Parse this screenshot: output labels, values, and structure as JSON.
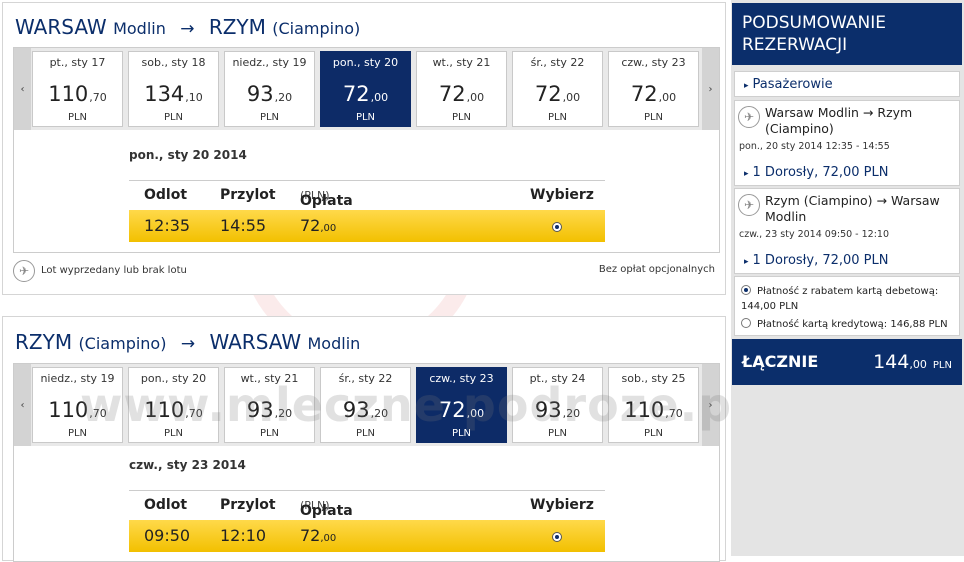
{
  "outbound": {
    "from_city": "WARSAW",
    "from_airport": "Modlin",
    "to_city": "RZYM",
    "to_airport": "(Ciampino)",
    "arrow": "→",
    "dates": [
      {
        "label": "pt., sty 17",
        "main": "110",
        "dec": ",70",
        "currency": "PLN",
        "selected": false
      },
      {
        "label": "sob., sty 18",
        "main": "134",
        "dec": ",10",
        "currency": "PLN",
        "selected": false
      },
      {
        "label": "niedz., sty 19",
        "main": "93",
        "dec": ",20",
        "currency": "PLN",
        "selected": false
      },
      {
        "label": "pon., sty 20",
        "main": "72",
        "dec": ",00",
        "currency": "PLN",
        "selected": true
      },
      {
        "label": "wt., sty 21",
        "main": "72",
        "dec": ",00",
        "currency": "PLN",
        "selected": false
      },
      {
        "label": "śr., sty 22",
        "main": "72",
        "dec": ",00",
        "currency": "PLN",
        "selected": false
      },
      {
        "label": "czw., sty 23",
        "main": "72",
        "dec": ",00",
        "currency": "PLN",
        "selected": false
      }
    ],
    "selected_date": "pon., sty 20 2014",
    "flight": {
      "depart": "12:35",
      "arrive": "14:55",
      "price_main": "72",
      "price_dec": ",00"
    }
  },
  "return": {
    "from_city": "RZYM",
    "from_airport": "(Ciampino)",
    "to_city": "WARSAW",
    "to_airport": "Modlin",
    "arrow": "→",
    "dates": [
      {
        "label": "niedz., sty 19",
        "main": "110",
        "dec": ",70",
        "currency": "PLN",
        "selected": false
      },
      {
        "label": "pon., sty 20",
        "main": "110",
        "dec": ",70",
        "currency": "PLN",
        "selected": false
      },
      {
        "label": "wt., sty 21",
        "main": "93",
        "dec": ",20",
        "currency": "PLN",
        "selected": false
      },
      {
        "label": "śr., sty 22",
        "main": "93",
        "dec": ",20",
        "currency": "PLN",
        "selected": false
      },
      {
        "label": "czw., sty 23",
        "main": "72",
        "dec": ",00",
        "currency": "PLN",
        "selected": true
      },
      {
        "label": "pt., sty 24",
        "main": "93",
        "dec": ",20",
        "currency": "PLN",
        "selected": false
      },
      {
        "label": "sob., sty 25",
        "main": "110",
        "dec": ",70",
        "currency": "PLN",
        "selected": false
      }
    ],
    "selected_date": "czw., sty 23 2014",
    "flight": {
      "depart": "09:50",
      "arrive": "12:10",
      "price_main": "72",
      "price_dec": ",00"
    }
  },
  "table_headers": {
    "depart": "Odlot",
    "arrive": "Przylot",
    "fare": "Opłata za transport",
    "fare_unit": "(PLN)",
    "select": "Wybierz"
  },
  "nav": {
    "prev": "‹",
    "next": "›"
  },
  "legend": {
    "sold_out": "Lot wyprzedany lub brak lotu",
    "note": "Bez opłat opcjonalnych"
  },
  "sidebar": {
    "title": "PODSUMOWANIE REZERWACJI",
    "passengers": "Pasażerowie",
    "out_route": "Warsaw Modlin → Rzym (Ciampino)",
    "out_when": "pon., 20 sty 2014 12:35 - 14:55",
    "out_fare": "1 Dorosły, 72,00 PLN",
    "ret_route": "Rzym (Ciampino) → Warsaw Modlin",
    "ret_when": "czw., 23 sty 2014 09:50 - 12:10",
    "ret_fare": "1 Dorosły, 72,00 PLN",
    "pay_debit": "Płatność z rabatem kartą debetową: 144,00 PLN",
    "pay_credit": "Płatność kartą kredytową: 146,88 PLN",
    "total_label": "ŁĄCZNIE",
    "total_main": "144",
    "total_dec": ",00",
    "total_cur": "PLN"
  },
  "watermark": "www.mleczne podroze.pl",
  "colors": {
    "brand_navy": "#0b2e6b",
    "selected_card": "#0d2b67",
    "flight_row": "#f2c000"
  }
}
